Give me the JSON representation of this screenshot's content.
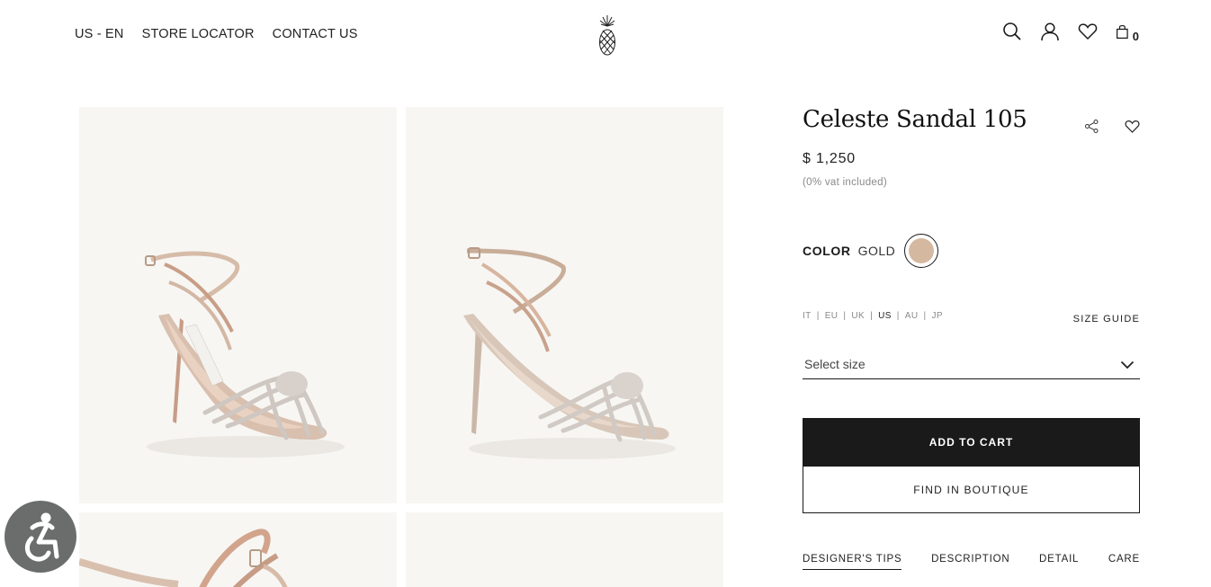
{
  "header": {
    "nav_left": [
      "US - EN",
      "STORE LOCATOR",
      "CONTACT US"
    ],
    "cart_count": "0",
    "icons": [
      "pineapple-logo",
      "search-icon",
      "user-icon",
      "heart-icon",
      "bag-icon"
    ]
  },
  "product": {
    "title": "Celeste Sandal 105",
    "price": "$ 1,250",
    "vat_note": "(0% vat included)",
    "color_label": "COLOR",
    "color_value": "GOLD",
    "swatch_color": "#d5b8a0",
    "size_systems": [
      "IT",
      "EU",
      "UK",
      "US",
      "AU",
      "JP"
    ],
    "active_size_system": "US",
    "size_guide": "SIZE GUIDE",
    "size_placeholder": "Select size",
    "add_to_cart": "ADD TO CART",
    "find_in_boutique": "FIND IN BOUTIQUE",
    "tabs": [
      "DESIGNER'S TIPS",
      "DESCRIPTION",
      "DETAIL",
      "CARE"
    ],
    "active_tab": "DESIGNER'S TIPS"
  },
  "colors": {
    "accent": "#1a1a1a",
    "tile_bg": "#f7f6f3",
    "a11y_bg": "#6b6d6c"
  }
}
